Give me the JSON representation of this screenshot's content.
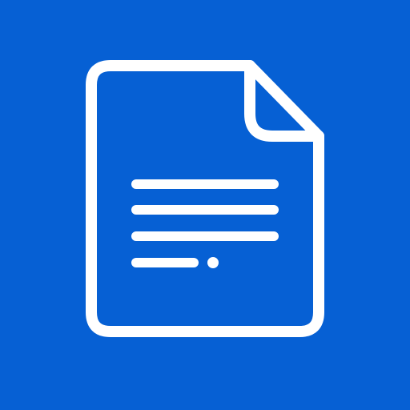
{
  "app_icon": {
    "icon_name": "document-icon",
    "background_color": "#0660d4",
    "foreground_color": "#ffffff",
    "text_lines": [
      "full-line",
      "full-line",
      "full-line",
      "short-line-with-dot"
    ]
  }
}
